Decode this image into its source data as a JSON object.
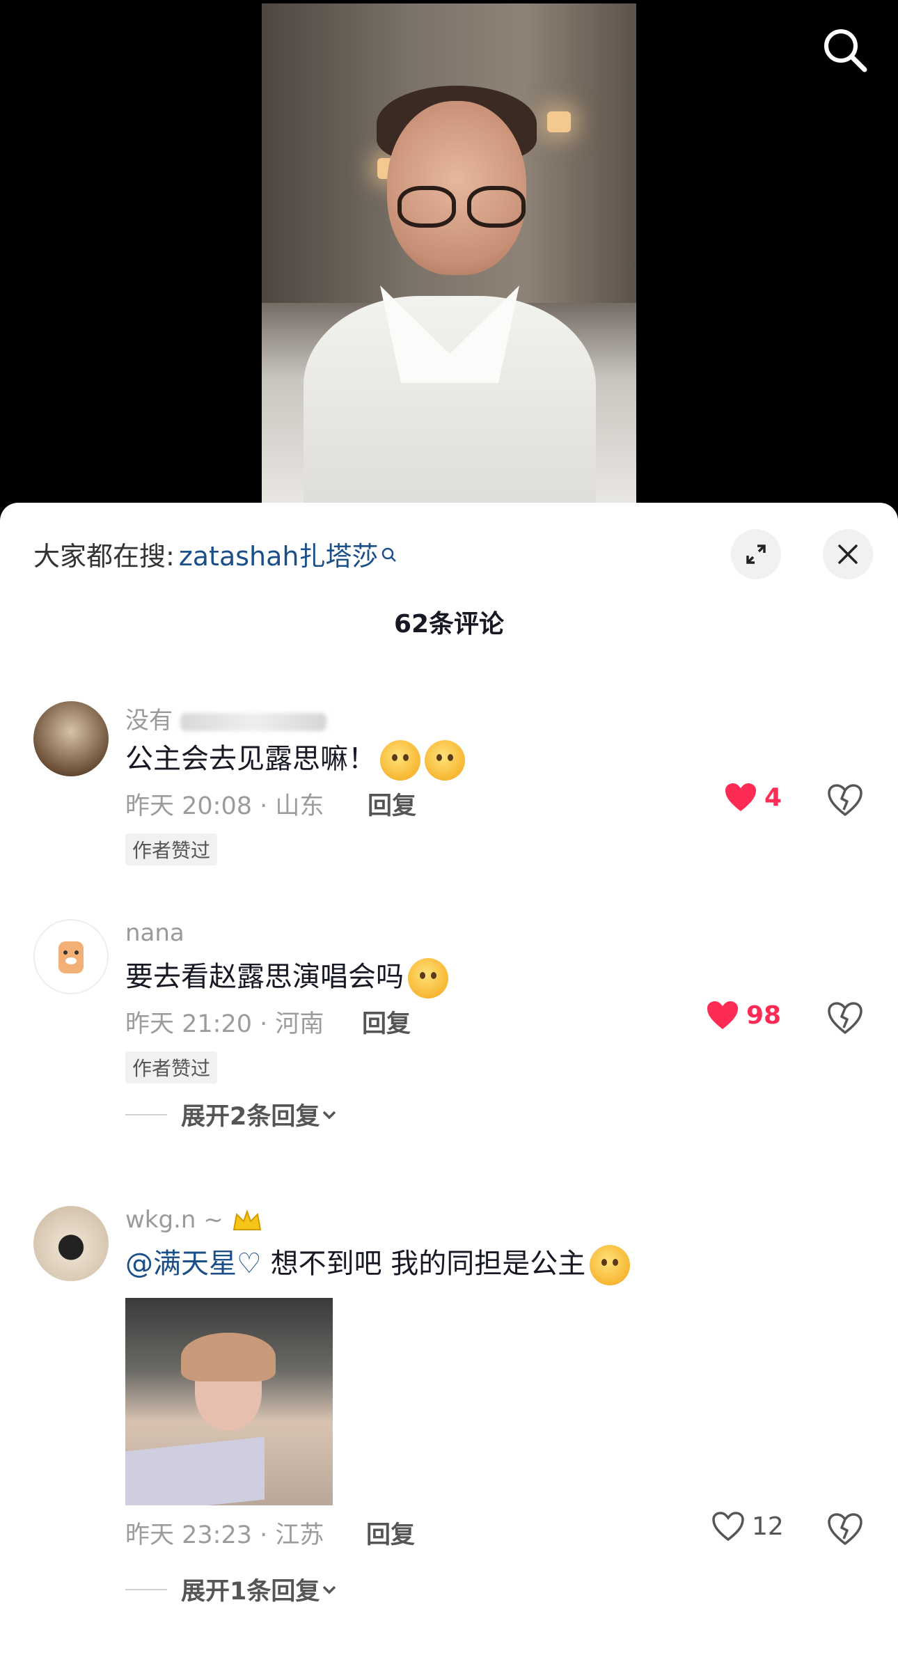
{
  "video": {
    "search_icon": "search-icon"
  },
  "sheet": {
    "trending_prefix": "大家都在搜:",
    "trending_keyword": "zatashah扎塔莎",
    "comment_count": "62条评论"
  },
  "comments": [
    {
      "username": "没有",
      "text": "公主会去见露思嘛！",
      "time_location": "昨天 20:08 · 山东",
      "reply_label": "回复",
      "likes": "4",
      "liked": true,
      "badge": "作者赞过"
    },
    {
      "username": "nana",
      "text": "要去看赵露思演唱会吗",
      "time_location": "昨天 21:20 · 河南",
      "reply_label": "回复",
      "likes": "98",
      "liked": true,
      "badge": "作者赞过",
      "expand_label": "展开2条回复"
    },
    {
      "username": "wkg.n ~",
      "mention": "@满天星♡",
      "text": "想不到吧 我的同担是公主",
      "time_location": "昨天 23:23 · 江苏",
      "reply_label": "回复",
      "likes": "12",
      "liked": false,
      "expand_label": "展开1条回复"
    }
  ],
  "colors": {
    "like_red": "#fe2c55",
    "link_blue": "#1b4f8a",
    "meta_gray": "#9c9c9c"
  }
}
